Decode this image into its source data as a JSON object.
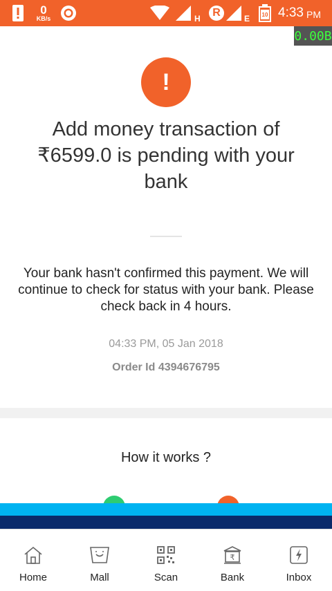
{
  "colors": {
    "accent": "#f1622a",
    "band_light": "#00b3f1",
    "band_dark": "#0a2a6a",
    "speed_text": "#3dff3d"
  },
  "status_bar": {
    "speed_value": "0",
    "speed_unit": "KB/s",
    "network_h": "H",
    "network_e": "E",
    "roaming": "R",
    "battery_level": "10",
    "time": "4:33",
    "ampm": "PM"
  },
  "overlay": {
    "data_counter": "0.00B"
  },
  "transaction": {
    "title": "Add money transaction of ₹6599.0 is pending with your bank",
    "message": "Your bank hasn't confirmed this payment. We will continue to check for status with your bank. Please check back in 4 hours.",
    "timestamp": "04:33 PM, 05 Jan 2018",
    "order_id": "Order Id 4394676795",
    "alert_symbol": "!"
  },
  "how_it_works": {
    "heading": "How it works ?"
  },
  "icons": {
    "status": "alert-icon",
    "home": "home-icon",
    "mall": "mall-icon",
    "scan": "qr-icon",
    "bank": "bank-icon",
    "inbox": "inbox-icon"
  },
  "bottom_nav": {
    "items": [
      {
        "label": "Home"
      },
      {
        "label": "Mall"
      },
      {
        "label": "Scan"
      },
      {
        "label": "Bank"
      },
      {
        "label": "Inbox"
      }
    ]
  }
}
